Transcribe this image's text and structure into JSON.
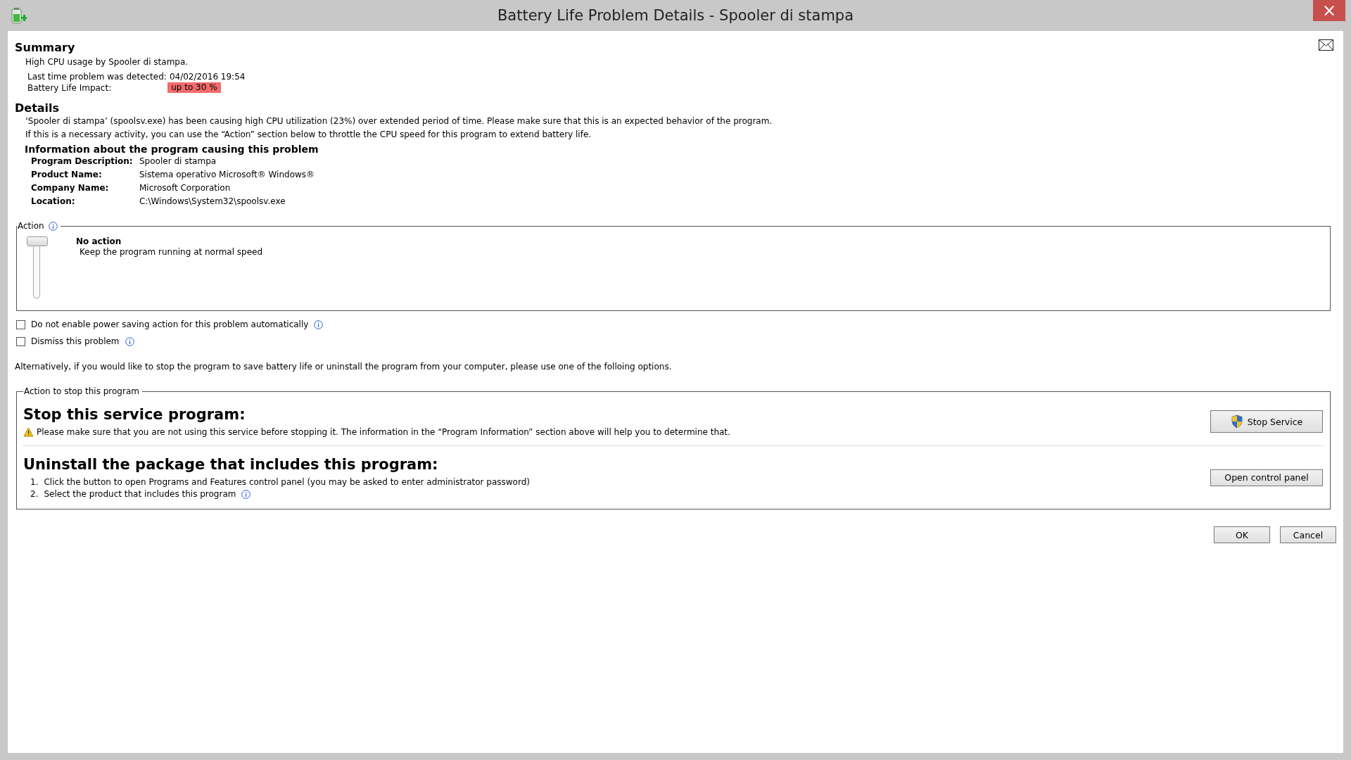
{
  "window": {
    "title": "Battery Life Problem Details - Spooler di stampa",
    "close": "×"
  },
  "summary": {
    "heading": "Summary",
    "text": "High CPU usage by Spooler di stampa.",
    "detected_label": "Last time problem was detected:",
    "detected_value": "04/02/2016 19:54",
    "impact_label": "Battery Life Impact:",
    "impact_value": "up to 30 %"
  },
  "details": {
    "heading": "Details",
    "lines": [
      "‘Spooler di stampa’ (spoolsv.exe) has been causing high CPU utilization (23%) over extended period of time. Please make sure that this is an expected behavior of the program.",
      "If this is a necessary activity, you can use the “Action” section below to throttle the CPU speed for this program to extend battery life."
    ],
    "info_heading": "Information about the program causing this problem",
    "info_rows": [
      {
        "label": "Program Description:",
        "value": "Spooler di stampa"
      },
      {
        "label": "Product Name:",
        "value": "Sistema operativo Microsoft® Windows®"
      },
      {
        "label": "Company Name:",
        "value": "Microsoft Corporation"
      },
      {
        "label": "Location:",
        "value": "C:\\Windows\\System32\\spoolsv.exe"
      }
    ]
  },
  "action": {
    "legend": "Action",
    "slider": {
      "level": 1
    },
    "title": "No action",
    "description": "Keep the program running at normal speed"
  },
  "options": [
    {
      "label": "Do not enable power saving action for this problem automatically",
      "checked": false
    },
    {
      "label": "Dismiss this problem",
      "checked": false
    }
  ],
  "alternative_text": "Alternatively, if you would like to stop the program to save battery life or uninstall the program from your computer, please use one of the folloing options.",
  "stop_section": {
    "legend": "Action to stop this program",
    "stop_heading": "Stop this service program:",
    "stop_warning": "Please make sure that you are not using this service before stopping it. The information in the “Program Information” section above will help you to determine that.",
    "stop_button": "Stop Service",
    "uninstall_heading": "Uninstall the package that includes this program:",
    "steps": [
      {
        "number": "1.",
        "text": "Click the button to open Programs and Features control panel (you may be asked to enter administrator password)"
      },
      {
        "number": "2.",
        "text": "Select the product that includes this program"
      }
    ],
    "control_panel_button": "Open control panel"
  },
  "buttons": [
    "OK",
    "Cancel"
  ]
}
